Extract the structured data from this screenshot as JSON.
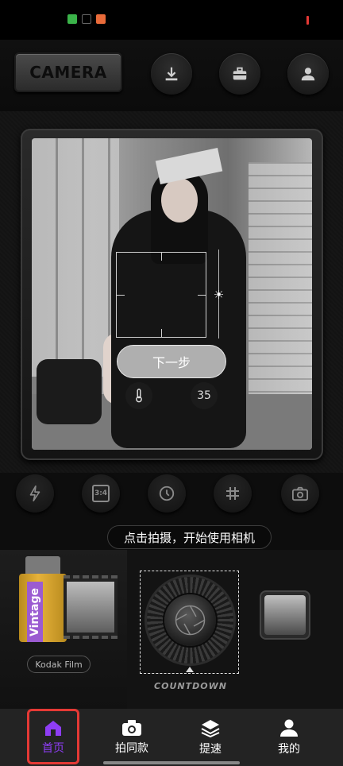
{
  "header": {
    "camera_label": "CAMERA",
    "icons": [
      "download-icon",
      "toolbox-icon",
      "user-icon"
    ]
  },
  "viewfinder": {
    "next_button": "下一步",
    "value_badge": "35",
    "left_icon": "thermometer-icon"
  },
  "tools": [
    "flash-icon",
    "aspect-ratio-icon",
    "timer-icon",
    "grid-icon",
    "switch-camera-icon"
  ],
  "aspect_label": "3:4",
  "hint": "点击拍摄，开始使用相机",
  "film": {
    "brand_text": "Vintage",
    "label": "Kodak Film"
  },
  "dial": {
    "caption": "COUNTDOWN"
  },
  "nav": {
    "items": [
      {
        "label": "首页",
        "icon": "home-icon"
      },
      {
        "label": "拍同款",
        "icon": "camera-icon"
      },
      {
        "label": "提速",
        "icon": "layers-icon"
      },
      {
        "label": "我的",
        "icon": "profile-icon"
      }
    ],
    "active_color": "#8e3df5",
    "highlight_color": "#e53935"
  }
}
